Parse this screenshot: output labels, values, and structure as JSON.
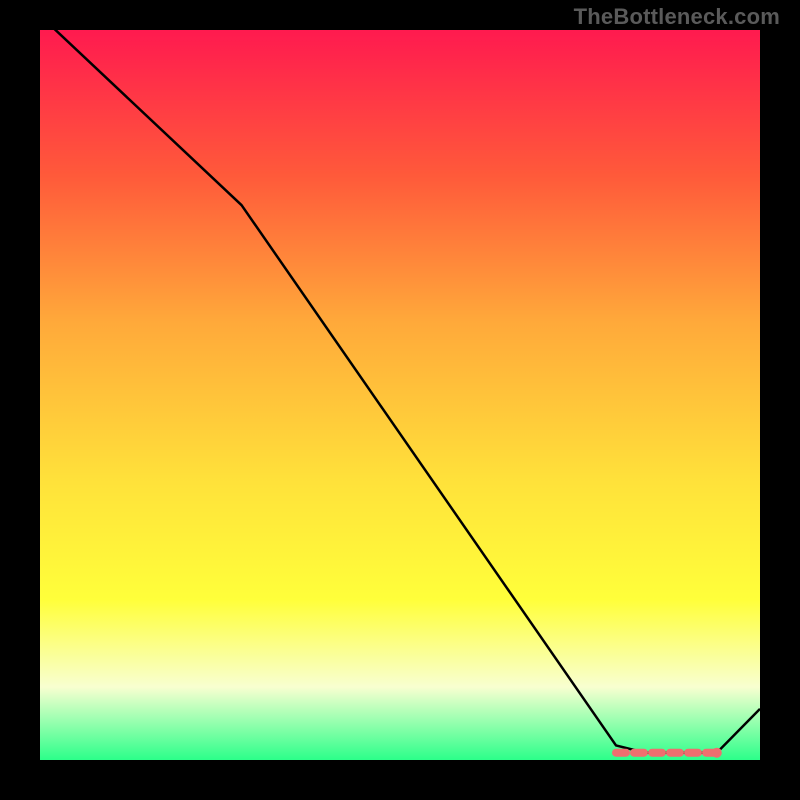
{
  "watermark": "TheBottleneck.com",
  "colors": {
    "grad_top": "#ff1a4f",
    "grad_mid_upper": "#ff5a3a",
    "grad_mid": "#ffa93a",
    "grad_mid_lower": "#ffe23a",
    "grad_yellow": "#ffff3a",
    "grad_light": "#f8ffd0",
    "grad_bottom": "#2cff8a",
    "line": "#000000",
    "band": "#ef6f6f"
  },
  "chart_data": {
    "type": "line",
    "title": "",
    "xlabel": "",
    "ylabel": "",
    "xlim": [
      0,
      100
    ],
    "ylim": [
      0,
      100
    ],
    "series": [
      {
        "name": "curve",
        "x": [
          0,
          28,
          80,
          84,
          94,
          100
        ],
        "y": [
          102,
          76,
          2,
          1,
          1,
          7
        ]
      }
    ],
    "optimal_band": {
      "x_start": 80,
      "x_end": 94,
      "y": 1
    }
  }
}
